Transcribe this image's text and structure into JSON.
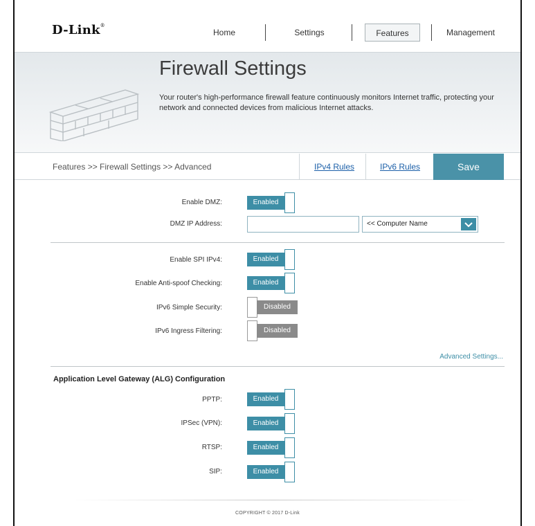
{
  "brand": {
    "name": "D-Link",
    "mark": "®"
  },
  "nav": {
    "home": "Home",
    "settings": "Settings",
    "features": "Features",
    "management": "Management"
  },
  "banner": {
    "title": "Firewall Settings",
    "description": "Your router's high-performance firewall feature continuously monitors Internet traffic, protecting your network and connected devices from malicious Internet attacks."
  },
  "breadcrumb": "Features >> Firewall Settings >> Advanced",
  "tabs": {
    "ipv4": "IPv4 Rules",
    "ipv6": "IPv6 Rules",
    "save": "Save"
  },
  "dmz": {
    "enable_label": "Enable DMZ:",
    "enable_state": "Enabled",
    "ip_label": "DMZ IP Address:",
    "ip_value": "",
    "computer_name": "<< Computer Name"
  },
  "security": {
    "spi_label": "Enable SPI IPv4:",
    "spi_state": "Enabled",
    "antispoof_label": "Enable Anti-spoof Checking:",
    "antispoof_state": "Enabled",
    "ipv6_simple_label": "IPv6 Simple Security:",
    "ipv6_simple_state": "Disabled",
    "ipv6_ingress_label": "IPv6 Ingress Filtering:",
    "ipv6_ingress_state": "Disabled",
    "advanced_link": "Advanced Settings..."
  },
  "alg": {
    "title": "Application Level Gateway (ALG) Configuration",
    "pptp_label": "PPTP:",
    "pptp_state": "Enabled",
    "ipsec_label": "IPSec (VPN):",
    "ipsec_state": "Enabled",
    "rtsp_label": "RTSP:",
    "rtsp_state": "Enabled",
    "sip_label": "SIP:",
    "sip_state": "Enabled"
  },
  "footer": {
    "copyright": "COPYRIGHT © 2017 D-Link"
  },
  "colors": {
    "accent": "#3d8ea6",
    "save": "#4a92a8",
    "disabled": "#8a8a8a",
    "link": "#1b5fa8"
  }
}
